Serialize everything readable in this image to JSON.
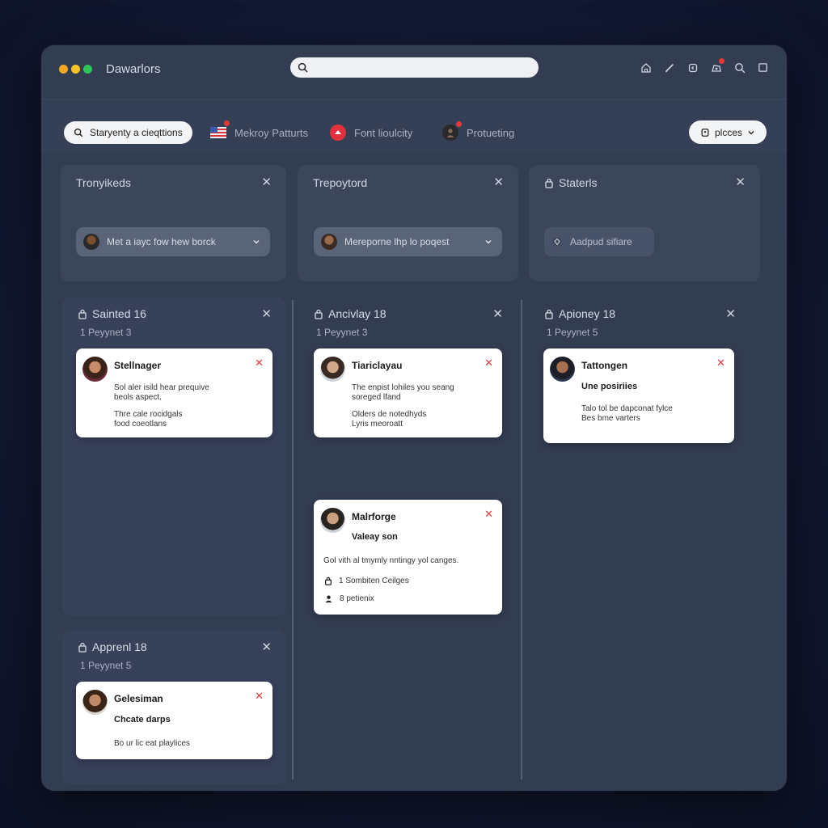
{
  "window": {
    "title": "Dawarlors",
    "dot_colors": [
      "#f5a623",
      "#f8c327",
      "#2ec55a"
    ],
    "search_placeholder": ""
  },
  "top_icons": [
    "home-icon",
    "pen-icon",
    "bookmark-icon",
    "notification-icon",
    "search-icon",
    "square-icon"
  ],
  "filters": {
    "active_chip": "Staryenty a cieqttions",
    "chips": [
      {
        "label": "Mekroy Patturts",
        "icon": "flag-icon"
      },
      {
        "label": "Font lioulcity",
        "icon": "pin-icon"
      },
      {
        "label": "Protueting",
        "icon": "person-icon"
      }
    ],
    "places_label": "plcces"
  },
  "top_panels": [
    {
      "title": "Tronyikeds",
      "select_label": "Met a iayc fow hew borck"
    },
    {
      "title": "Trepoytord",
      "select_label": "Mereporne lhp lo poqest"
    },
    {
      "title": "Staterls",
      "select_label": "Aadpud sifiare"
    }
  ],
  "columns": [
    {
      "title": "Sainted 16",
      "subtitle": "1  Peyynet 3",
      "cards": [
        {
          "name": "Stellnager",
          "lines_a": [
            "Sol aler isild hear prequive",
            "beols aspect."
          ],
          "lines_b": [
            "Thre cale rocidgals",
            "food coeotlans"
          ]
        }
      ]
    },
    {
      "title": "Ancivlay 18",
      "subtitle": "1  Peyynet 3",
      "cards": [
        {
          "name": "Tiariclayau",
          "lines_a": [
            "The enpist lohiles you seang",
            "soreged lfand"
          ],
          "lines_b": [
            "Olders de notedhyds",
            "Lyris meoroatt"
          ]
        },
        {
          "name": "Malrforge",
          "sub": "Valeay son",
          "body": "Gol vith al tmymly nntingy yol canges.",
          "meta": [
            {
              "icon": "lock-icon",
              "text": "1  Sombiten Ceilges"
            },
            {
              "icon": "user-icon",
              "text": "8  petienix"
            }
          ]
        }
      ]
    },
    {
      "title": "Apioney 18",
      "subtitle": "1  Peyynet 5",
      "cards": [
        {
          "name": "Tattongen",
          "sub": "Une posiriies",
          "lines_a": [
            "Talo tol be dapconat fylce",
            "Bes bme varters"
          ]
        }
      ]
    },
    {
      "title": "Apprenl 18",
      "subtitle": "1  Peyynet 5",
      "cards": [
        {
          "name": "Gelesiman",
          "sub": "Chcate darps",
          "body": "Bo ur lic eat playlices"
        }
      ]
    }
  ]
}
